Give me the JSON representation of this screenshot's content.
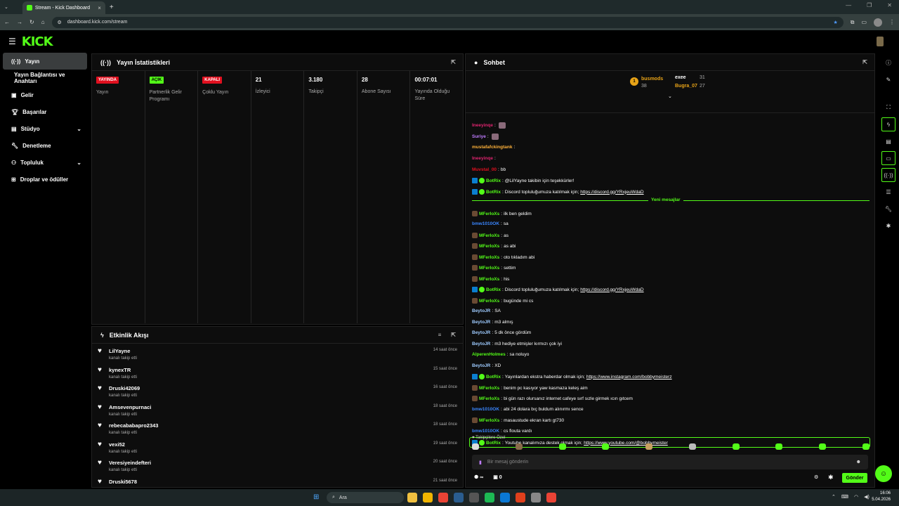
{
  "browser": {
    "tab_title": "Stream - Kick Dashboard",
    "url": "dashboard.kick.com/stream",
    "new_tab": "+",
    "win_controls": [
      "—",
      "❐",
      "✕"
    ]
  },
  "brand": {
    "logo": "KICK",
    "accent": "#53fc18"
  },
  "sidebar": {
    "items": [
      {
        "label": "Yayın",
        "icon": "broadcast-icon",
        "active": true
      },
      {
        "label": "Yayın Bağlantısı ve Anahtarı",
        "icon": "",
        "sub": true
      },
      {
        "label": "Gelir",
        "icon": "wallet-icon"
      },
      {
        "label": "Başarılar",
        "icon": "trophy-icon"
      },
      {
        "label": "Stüdyo",
        "icon": "studio-icon",
        "chevron": true
      },
      {
        "label": "Denetleme",
        "icon": "wrench-icon"
      },
      {
        "label": "Topluluk",
        "icon": "community-icon",
        "chevron": true
      },
      {
        "label": "Droplar ve ödüller",
        "icon": "gift-icon"
      }
    ]
  },
  "stats": {
    "title": "Yayın İstatistikleri",
    "cells": [
      {
        "badge": "YAYINDA",
        "badge_color": "#e0101f",
        "label": "Yayın"
      },
      {
        "badge": "AÇIK",
        "badge_color": "#53fc18",
        "label": "Partnerlik Gelir Programı"
      },
      {
        "badge": "KAPALI",
        "badge_color": "#e0101f",
        "label": "Çoklu Yayın"
      },
      {
        "value": "21",
        "label": "İzleyici"
      },
      {
        "value": "3.180",
        "label": "Takipçi"
      },
      {
        "value": "28",
        "label": "Abone Sayısı"
      },
      {
        "value": "00:07:01",
        "label": "Yayında Olduğu Süre"
      }
    ]
  },
  "activity": {
    "title": "Etkinlik Akışı",
    "items": [
      {
        "name": "LilYayne",
        "sub": "kanalı takip etti",
        "time": "14 saat önce"
      },
      {
        "name": "kynexTR",
        "sub": "kanalı takip etti",
        "time": "15 saat önce"
      },
      {
        "name": "Druski42069",
        "sub": "kanalı takip etti",
        "time": "16 saat önce"
      },
      {
        "name": "Amsevenpurnaci",
        "sub": "kanalı takip etti",
        "time": "18 saat önce"
      },
      {
        "name": "rebecababapro2343",
        "sub": "kanalı takip etti",
        "time": "18 saat önce"
      },
      {
        "name": "vexi52",
        "sub": "kanalı takip etti",
        "time": "19 saat önce"
      },
      {
        "name": "Veresiyeindefteri",
        "sub": "kanalı takip etti",
        "time": "20 saat önce"
      },
      {
        "name": "Druski5678",
        "sub": "",
        "time": "21 saat önce"
      }
    ]
  },
  "chat": {
    "title": "Sohbet",
    "leaders": [
      {
        "rank": "1",
        "name": "busmods",
        "count": "38"
      },
      {
        "name": "exee",
        "count": "31"
      },
      {
        "name": "Bugra_07",
        "count": "27"
      }
    ],
    "new_label": "Yeni mesajlar",
    "messages": [
      {
        "user": "Ineeyinqe",
        "color": "#e0246f",
        "text": "",
        "emote": true
      },
      {
        "user": "Suriye",
        "color": "#c07cff",
        "text": "",
        "emote": true
      },
      {
        "user": "mustafafckingtank",
        "color": "#ffb23a",
        "text": ""
      },
      {
        "user": "Ineeyinqe",
        "color": "#e0246f",
        "text": ""
      },
      {
        "user": "Muvstal_00",
        "color": "#e0101f",
        "text": "bb"
      },
      {
        "user": "BotRix",
        "color": "#53fc18",
        "text": "@LilYayne takibin için teşekkürler!",
        "bot": true
      },
      {
        "user": "BotRix",
        "color": "#53fc18",
        "text": "Discord topluluğumuza katılmak için; ",
        "link": "https://discord.gg/YRxjeuWdaD",
        "bot": true
      },
      {
        "user": "MFerIoXs",
        "color": "#53fc18",
        "text": "ilk ben geldim",
        "emote": true
      },
      {
        "user": "bmw1010OK",
        "color": "#3a86ff",
        "text": "sa"
      },
      {
        "user": "MFerIoXs",
        "color": "#53fc18",
        "text": "as",
        "emote": true
      },
      {
        "user": "MFerIoXs",
        "color": "#53fc18",
        "text": "as abi",
        "emote": true
      },
      {
        "user": "MFerIoXs",
        "color": "#53fc18",
        "text": "oto tıkladım abi",
        "emote": true
      },
      {
        "user": "MFerIoXs",
        "color": "#53fc18",
        "text": "settim",
        "emote": true
      },
      {
        "user": "MFerIoXs",
        "color": "#53fc18",
        "text": "his",
        "emote": true
      },
      {
        "user": "BotRix",
        "color": "#53fc18",
        "text": "Discord topluluğumuza katılmak için; ",
        "link": "https://discord.gg/YRxjeuWdaD",
        "bot": true
      },
      {
        "user": "MFerIoXs",
        "color": "#53fc18",
        "text": "bugünde mi cs",
        "emote": true
      },
      {
        "user": "BeytoJR",
        "color": "#9ecbff",
        "text": "SA"
      },
      {
        "user": "BeytoJR",
        "color": "#9ecbff",
        "text": "m3 almış"
      },
      {
        "user": "BeytoJR",
        "color": "#9ecbff",
        "text": "5 dk önce gördüm"
      },
      {
        "user": "BeytoJR",
        "color": "#9ecbff",
        "text": "m3 hediye etmişler kırmızı çok iyi"
      },
      {
        "user": "AlperenHolmes",
        "color": "#53fc18",
        "text": "sa noluyo"
      },
      {
        "user": "BeytoJR",
        "color": "#9ecbff",
        "text": "XD"
      },
      {
        "user": "BotRix",
        "color": "#53fc18",
        "text": "Yayınlardan ekstra haberdar olmak için; ",
        "link": "https://www.instagram.com/bobbymeisterz",
        "bot": true
      },
      {
        "user": "MFerIoXs",
        "color": "#53fc18",
        "text": "benim pc kasıyor yaw kasmaza keleş aim",
        "emote": true
      },
      {
        "user": "MFerIoXs",
        "color": "#53fc18",
        "text": "bi gün razı olursanız internet cafeye sırf sızle girmek ıcın gıtcem",
        "emote": true
      },
      {
        "user": "bmw1010OK",
        "color": "#3a86ff",
        "text": "abi 24 dolara bıç buldum alınırmı sence"
      },
      {
        "user": "MFerIoXs",
        "color": "#53fc18",
        "text": "masaustude ekran kartı gt730",
        "emote": true
      },
      {
        "user": "bmw1010OK",
        "color": "#3a86ff",
        "text": "cs flouta vardı"
      },
      {
        "user": "BotRix",
        "color": "#53fc18",
        "text": "Youtube kanalımıza destek olmak için; ",
        "link": "https://www.youtube.com/@bobbymeister",
        "bot": true
      }
    ],
    "followers_label": "Takipçilere Özel",
    "input_placeholder": "Bir mesaj gönderin",
    "points": "∞",
    "gift_count": "0",
    "send_label": "Gönder"
  },
  "taskbar": {
    "search": "Ara",
    "time": "16:06",
    "date": "5.04.2026"
  }
}
